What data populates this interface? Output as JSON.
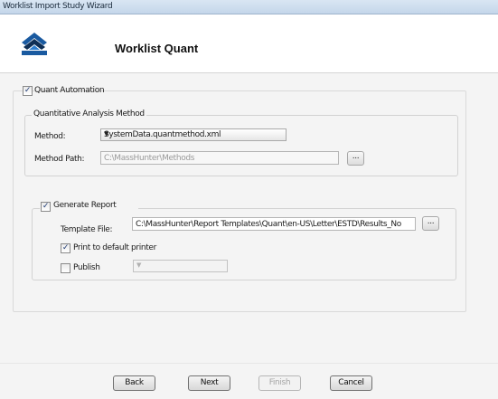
{
  "window": {
    "title": "Worklist Import Study Wizard"
  },
  "wizard": {
    "heading": "Worklist Quant",
    "logo_icon": "stacked-chevrons-logo"
  },
  "quant_automation": {
    "label": "Quant Automation",
    "checked": true,
    "method_group": {
      "title": "Quantitative Analysis Method",
      "method_label": "Method:",
      "method_value": "SystemData.quantmethod.xml",
      "path_label": "Method Path:",
      "path_value": "C:\\MassHunter\\Methods",
      "browse_label": "..."
    },
    "report": {
      "label": "Generate Report",
      "checked": true,
      "template_label": "Template File:",
      "template_value": "C:\\MassHunter\\Report Templates\\Quant\\en-US\\Letter\\ESTD\\Results_No",
      "browse_label": "...",
      "print_label": "Print to default printer",
      "print_checked": true,
      "publish_label": "Publish",
      "publish_checked": false,
      "publish_value": ""
    }
  },
  "buttons": {
    "back": "Back",
    "next": "Next",
    "finish": "Finish",
    "cancel": "Cancel"
  },
  "colors": {
    "logo_blue": "#1a5aa0",
    "logo_dark": "#0f2f55",
    "check_mark": "#1f3b74"
  }
}
